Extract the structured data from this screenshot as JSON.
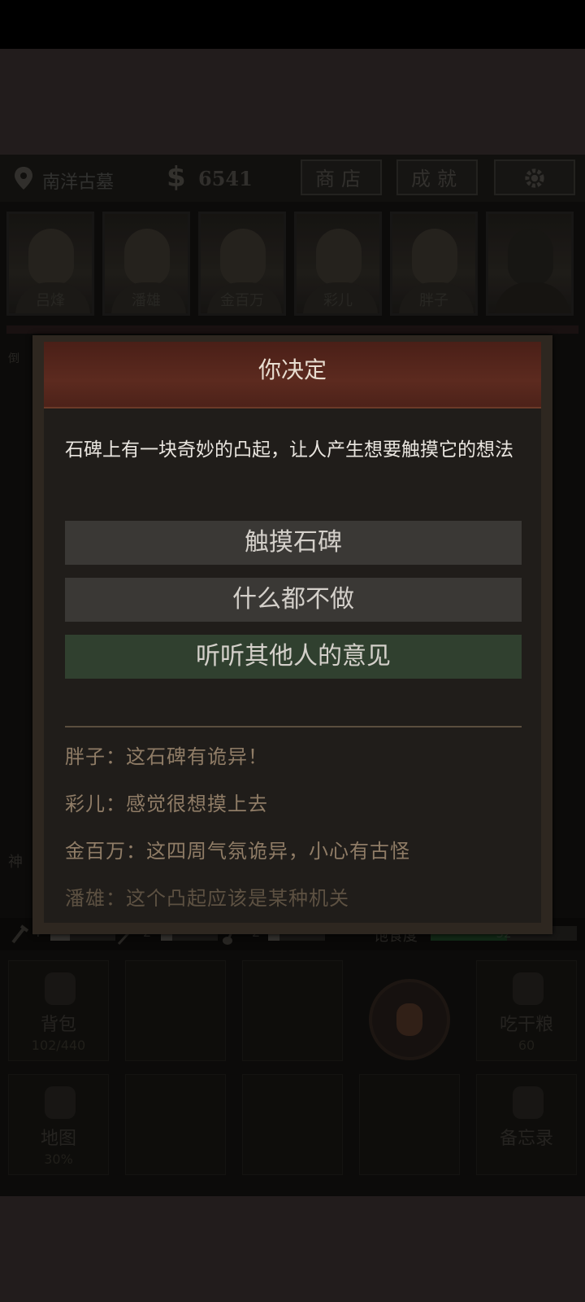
{
  "topbar": {
    "location": "南洋古墓",
    "money_symbol": "$",
    "money": "6541",
    "shop_label": "商店",
    "achievements_label": "成就",
    "settings_icon": "gear-icon"
  },
  "party": [
    {
      "name": "吕烽"
    },
    {
      "name": "潘雄"
    },
    {
      "name": "金百万"
    },
    {
      "name": "彩儿"
    },
    {
      "name": "胖子"
    },
    {
      "name": ""
    }
  ],
  "side_tags": {
    "left_top": "倒",
    "left_mid": "神"
  },
  "stats": {
    "tool1": "4",
    "tool2": "2",
    "tool3": "2",
    "hunger_label": "饱食度",
    "hunger_value": "52",
    "hunger_fraction": 0.52
  },
  "grid": {
    "backpack_label": "背包",
    "backpack_count": "102/440",
    "eat_label": "吃干粮",
    "eat_count": "60",
    "map_label": "地图",
    "map_progress": "30%",
    "memo_label": "备忘录"
  },
  "dialog": {
    "title": "你决定",
    "message": "石碑上有一块奇妙的凸起，让人产生想要触摸它的想法",
    "choices": [
      "触摸石碑",
      "什么都不做",
      "听听其他人的意见"
    ],
    "remarks": [
      "胖子：这石碑有诡异！",
      "彩儿：感觉很想摸上去",
      "金百万：这四周气氛诡异，小心有古怪",
      "潘雄：这个凸起应该是某种机关"
    ]
  },
  "colors": {
    "dialog_header": "#5c2a1f",
    "choice_default": "#3a3835",
    "choice_highlight": "#30402f",
    "remark_text": "#8f7c66"
  }
}
